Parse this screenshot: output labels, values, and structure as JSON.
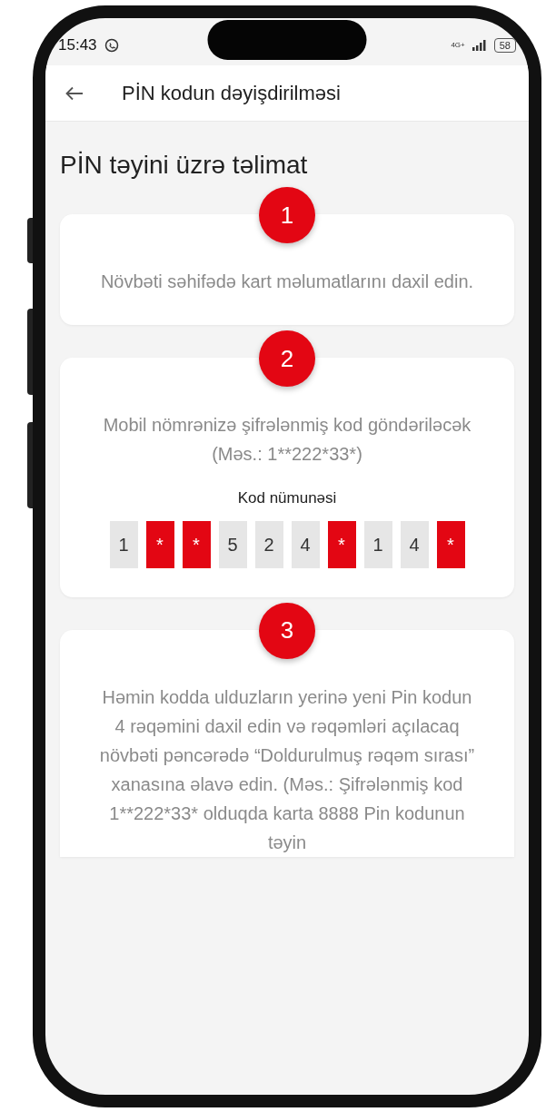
{
  "status_bar": {
    "time": "15:43",
    "network": "4G+",
    "battery": "58"
  },
  "header": {
    "title": "PİN kodun dəyişdirilməsi"
  },
  "heading": "PİN təyini üzrə təlimat",
  "steps": [
    {
      "number": "1",
      "text": "Növbəti səhifədə kart məlumatlarını daxil edin."
    },
    {
      "number": "2",
      "text": "Mobil nömrənizə şifrələnmiş kod göndəriləcək (Məs.: 1**222*33*)",
      "example_label": "Kod nümunəsi",
      "cells": [
        {
          "kind": "digit",
          "text": "1"
        },
        {
          "kind": "mask",
          "text": "*"
        },
        {
          "kind": "mask",
          "text": "*"
        },
        {
          "kind": "digit",
          "text": "5"
        },
        {
          "kind": "digit",
          "text": "2"
        },
        {
          "kind": "digit",
          "text": "4"
        },
        {
          "kind": "mask",
          "text": "*"
        },
        {
          "kind": "digit",
          "text": "1"
        },
        {
          "kind": "digit",
          "text": "4"
        },
        {
          "kind": "mask",
          "text": "*"
        }
      ]
    },
    {
      "number": "3",
      "text": "Həmin kodda ulduzların yerinə yeni Pin kodun 4 rəqəmini daxil edin və rəqəmləri açılacaq növbəti pəncərədə “Doldurulmuş rəqəm sırası” xanasına əlavə edin. (Məs.: Şifrələnmiş kod 1**222*33* olduqda karta 8888 Pin kodunun təyin"
    }
  ]
}
